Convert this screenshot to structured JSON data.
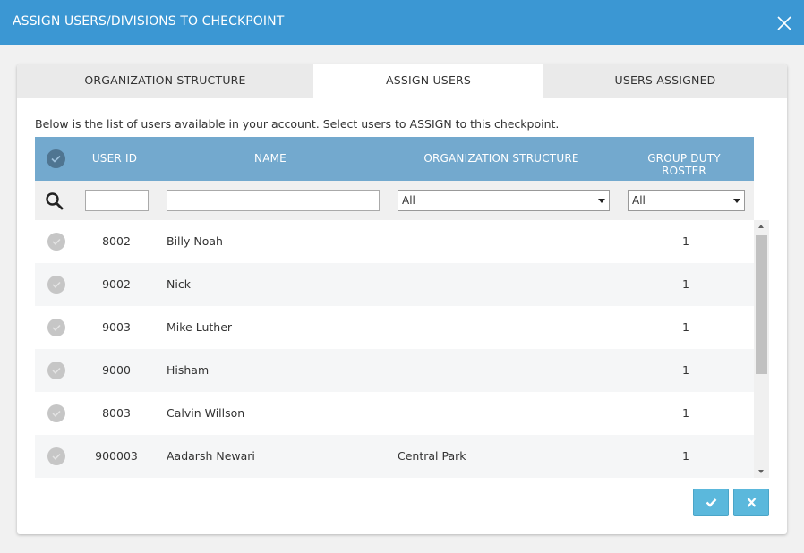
{
  "dialog": {
    "title": "ASSIGN USERS/DIVISIONS TO CHECKPOINT",
    "close_icon": "close-icon"
  },
  "tabs": [
    {
      "label": "ORGANIZATION STRUCTURE",
      "active": false
    },
    {
      "label": "ASSIGN USERS",
      "active": true
    },
    {
      "label": "USERS ASSIGNED",
      "active": false
    }
  ],
  "description": "Below is the list of users available in your account. Select users to ASSIGN to this checkpoint.",
  "table": {
    "columns": [
      "USER ID",
      "NAME",
      "ORGANIZATION STRUCTURE",
      "GROUP DUTY ROSTER"
    ],
    "filters": {
      "user_id": "",
      "name": "",
      "organization_structure": "All",
      "group_duty_roster": "All"
    },
    "rows": [
      {
        "user_id": "8002",
        "name": "Billy Noah",
        "org": "",
        "roster": "1"
      },
      {
        "user_id": "9002",
        "name": "Nick",
        "org": "",
        "roster": "1"
      },
      {
        "user_id": "9003",
        "name": "Mike Luther",
        "org": "",
        "roster": "1"
      },
      {
        "user_id": "9000",
        "name": "Hisham",
        "org": "",
        "roster": "1"
      },
      {
        "user_id": "8003",
        "name": "Calvin Willson",
        "org": "",
        "roster": "1"
      },
      {
        "user_id": "900003",
        "name": "Aadarsh Newari",
        "org": "Central Park",
        "roster": "1"
      }
    ]
  },
  "colors": {
    "titlebar": "#3b97d3",
    "table_header": "#73a9ce",
    "button": "#5bb8dc"
  }
}
